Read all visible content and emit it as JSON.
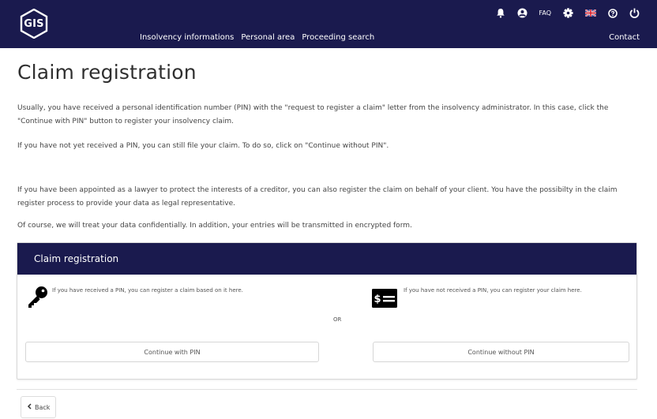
{
  "header": {
    "logo": "GIS",
    "nav": [
      "Insolvency informations",
      "Personal area",
      "Proceeding search"
    ],
    "faq": "FAQ",
    "contact": "Contact"
  },
  "colors": {
    "primary": "#1a1a4e",
    "text": "#3a3a3a"
  },
  "icons": [
    "bell-icon",
    "user-icon",
    "gear-icon",
    "uk-flag-icon",
    "help-icon",
    "power-icon",
    "key-icon",
    "money-icon",
    "chevron-left-icon"
  ],
  "main": {
    "title": "Claim registration",
    "paragraphs": [
      "Usually, you have received a personal identification number (PIN) with the \"request to register a claim\" letter from the insolvency administrator. In this case, click the \"Continue with PIN\" button to register your insolvency claim.",
      "If you have not yet received a PIN, you can still file your claim. To do so, click on \"Continue without PIN\".",
      "If you have been appointed as a lawyer to protect the interests of a creditor, you can also register the claim on behalf of your client. You have the possibilty in the claim register process to provide your data as legal representative.",
      "Of course, we will treat your data confidentially. In addition, your entries will be transmitted in encrypted form."
    ]
  },
  "card": {
    "title": "Claim registration",
    "pin_text": "If you have received a PIN, you can register a claim based on it here.",
    "or": "OR",
    "nopin_text": "If you have not received a PIN, you can register your claim here.",
    "btn_pin": "Continue with PIN",
    "btn_nopin": "Continue without PIN"
  },
  "footer": {
    "back": "Back"
  }
}
